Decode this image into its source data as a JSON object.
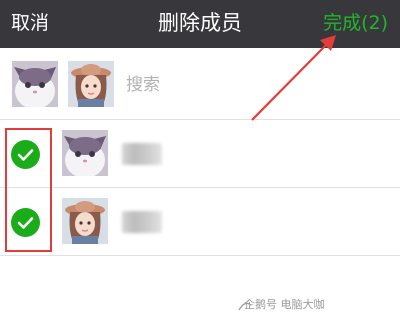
{
  "navbar": {
    "cancel_label": "取消",
    "title": "删除成员",
    "done_label": "完成(2)"
  },
  "selected_strip": {
    "search_placeholder": "搜索"
  },
  "members": [
    {
      "selected": true,
      "avatar_icon": "cat-avatar"
    },
    {
      "selected": true,
      "avatar_icon": "girl-avatar"
    }
  ],
  "watermark": "企鹅号 电脑大咖",
  "colors": {
    "navbar_bg": "#38383c",
    "done_accent": "#1fb629",
    "check_green": "#1aad19",
    "annotation_red": "#e43b3b"
  }
}
